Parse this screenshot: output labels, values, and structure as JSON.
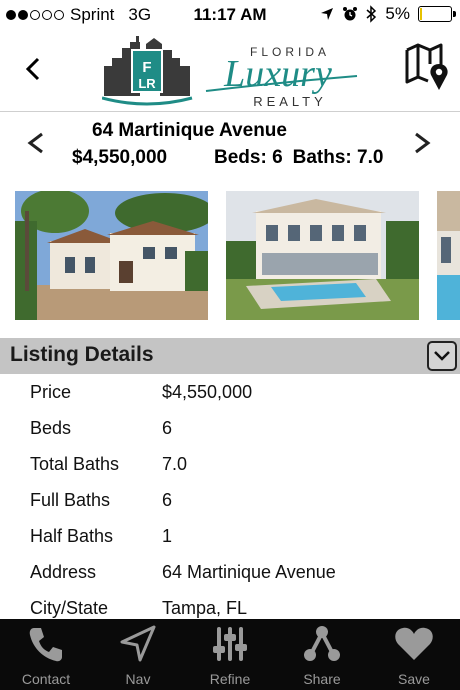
{
  "status_bar": {
    "signal_dots": [
      true,
      true,
      false,
      false,
      false
    ],
    "carrier": "Sprint",
    "network": "3G",
    "time": "11:17 AM",
    "battery": "5%",
    "battery_level": 0.05,
    "battery_color": "#e6c200"
  },
  "header": {
    "back_icon": "chevron-left-icon",
    "logo": {
      "word_top": "FLORIDA",
      "word_main": "Luxury",
      "word_bottom": "REALTY",
      "brand_color": "#1f8c86",
      "mark_letters": "FLR"
    },
    "map_icon": "map-pin-icon"
  },
  "property": {
    "address": "64 Martinique Avenue",
    "price": "$4,550,000",
    "beds": "Beds: 6",
    "baths": "Baths: 7.0"
  },
  "section": {
    "title": "Listing Details",
    "toggle_icon": "chevron-down-icon"
  },
  "details": [
    {
      "label": "Price",
      "value": "$4,550,000"
    },
    {
      "label": "Beds",
      "value": "6"
    },
    {
      "label": "Total Baths",
      "value": "7.0"
    },
    {
      "label": "Full Baths",
      "value": "6"
    },
    {
      "label": "Half Baths",
      "value": "1"
    },
    {
      "label": "Address",
      "value": "64 Martinique Avenue"
    },
    {
      "label": "City/State",
      "value": "Tampa, FL"
    }
  ],
  "tabs": [
    {
      "label": "Contact",
      "icon": "phone-icon"
    },
    {
      "label": "Nav",
      "icon": "navigation-arrow-icon"
    },
    {
      "label": "Refine",
      "icon": "sliders-icon"
    },
    {
      "label": "Share",
      "icon": "share-icon"
    },
    {
      "label": "Save",
      "icon": "heart-icon"
    }
  ]
}
